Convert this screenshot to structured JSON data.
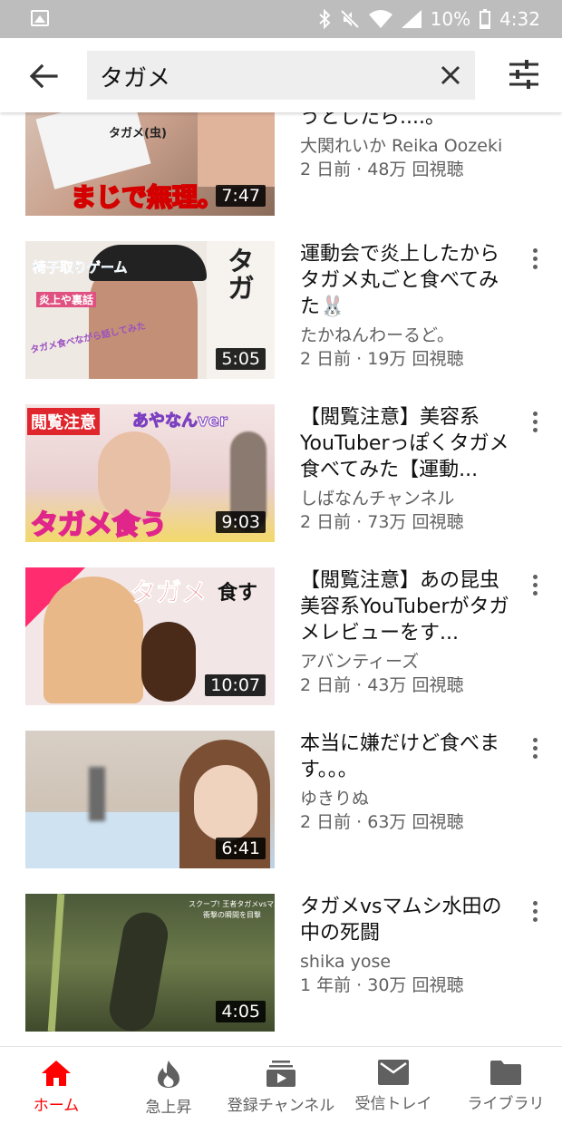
{
  "status_bar": {
    "battery": "10%",
    "time": "4:32"
  },
  "search": {
    "query": "タガメ"
  },
  "results": [
    {
      "title": "※】タガメ(虫)を食べようとしたら....。",
      "channel": "大関れいか Reika Oozeki",
      "meta": "2 日前 · 48万 回視聴",
      "duration": "7:47",
      "thumb_text": [
        "まじで無理。",
        "タガメ(虫)"
      ]
    },
    {
      "title": "運動会で炎上したからタガメ丸ごと食べてみた🐰",
      "channel": "たかねんわーるど。",
      "meta": "2 日前 · 19万 回視聴",
      "duration": "5:05",
      "thumb_text": [
        "椅子取りゲーム",
        "炎上や裏話",
        "タガメ食べながら話してみた",
        "タガ"
      ]
    },
    {
      "title": "【閲覧注意】美容系YouTuberっぽくタガメ食べてみた【運動...",
      "channel": "しばなんチャンネル",
      "meta": "2 日前 · 73万 回視聴",
      "duration": "9:03",
      "thumb_text": [
        "閲覧注意",
        "あやなんver",
        "タガメ食う"
      ]
    },
    {
      "title": "【閲覧注意】あの昆虫美容系YouTuberがタガメレビューをす...",
      "channel": "アバンティーズ",
      "meta": "2 日前 · 43万 回視聴",
      "duration": "10:07",
      "thumb_text": [
        "タガメ",
        "食す"
      ]
    },
    {
      "title": "本当に嫌だけど食べます。。。",
      "channel": "ゆきりぬ",
      "meta": "2 日前 · 63万 回視聴",
      "duration": "6:41",
      "thumb_text": []
    },
    {
      "title": "タガメvsマムシ水田の中の死闘",
      "channel": "shika yose",
      "meta": "1 年前 · 30万 回視聴",
      "duration": "4:05",
      "thumb_text": [
        "スクープ! 王者タガメvsマムシ",
        "衝撃の瞬間を目撃"
      ]
    }
  ],
  "bottom_nav": [
    {
      "label": "ホーム",
      "icon": "home-icon",
      "active": true
    },
    {
      "label": "急上昇",
      "icon": "trending-icon",
      "active": false
    },
    {
      "label": "登録チャンネル",
      "icon": "subscriptions-icon",
      "active": false
    },
    {
      "label": "受信トレイ",
      "icon": "inbox-icon",
      "active": false
    },
    {
      "label": "ライブラリ",
      "icon": "library-icon",
      "active": false
    }
  ],
  "colors": {
    "accent": "#ff0000",
    "status_bar": "#bdbdbd",
    "secondary_text": "#606060"
  }
}
